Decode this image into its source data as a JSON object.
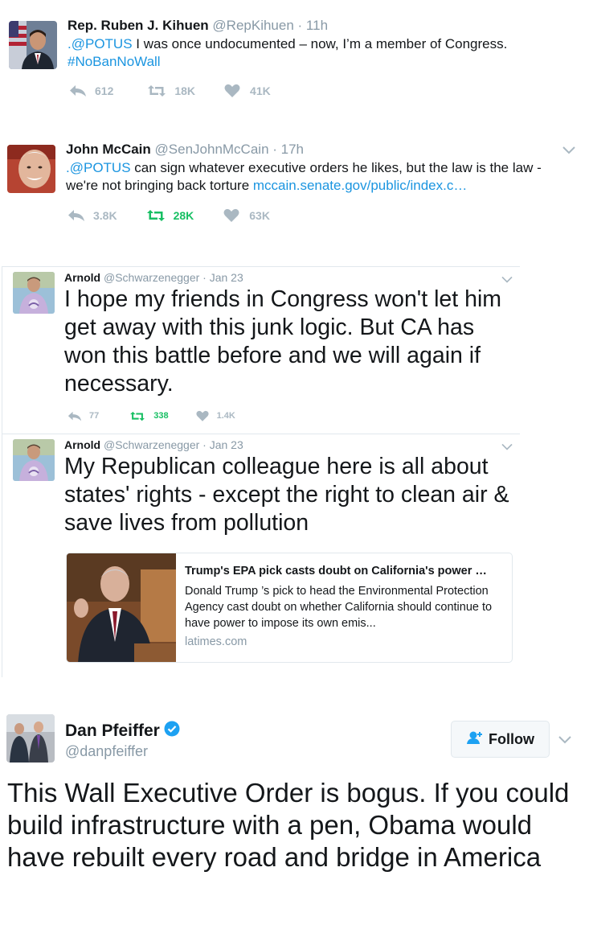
{
  "tweets": [
    {
      "name": "Rep. Ruben J. Kihuen",
      "handle": "@RepKihuen",
      "time": "· 11h",
      "mention": ".@POTUS",
      "text": " I was once undocumented – now, I’m a member of Congress.",
      "hashtag": "#NoBanNoWall",
      "replies": "612",
      "retweets": "18K",
      "likes": "41K"
    },
    {
      "name": "John McCain",
      "handle": "@SenJohnMcCain",
      "time": "· 17h",
      "mention": ".@POTUS",
      "text": " can sign whatever executive orders he likes, but the law is the law - we're not bringing back torture ",
      "url": "mccain.senate.gov/public/index.c…",
      "replies": "3.8K",
      "retweets": "28K",
      "likes": "63K"
    },
    {
      "name": "Arnold",
      "handle": "@Schwarzenegger",
      "time": "· Jan 23",
      "text": "I hope my friends in Congress won't let him get away with this junk logic. But CA has won this battle before and we will again if necessary.",
      "replies": "77",
      "retweets": "338",
      "likes": "1.4K"
    },
    {
      "name": "Arnold",
      "handle": "@Schwarzenegger",
      "time": "· Jan 23",
      "text": "My Republican colleague here is all about states' rights - except the right to clean air & save lives from pollution",
      "card": {
        "title": "Trump's EPA pick casts doubt on California's power …",
        "description": "Donald Trump ’s pick to head the Environmental Protection Agency cast doubt on whether California should continue to have power to impose its own emis...",
        "domain": "latimes.com"
      }
    },
    {
      "name": "Dan Pfeiffer",
      "handle": "@danpfeiffer",
      "follow_label": "Follow",
      "text": "This Wall Executive Order is bogus. If you could build infrastructure with a pen, Obama would have rebuilt every road and bridge in America"
    }
  ],
  "colors": {
    "link": "#1b95e0",
    "muted": "#8899a6",
    "retweet_active": "#17bf63",
    "icon": "#aab8c2"
  }
}
